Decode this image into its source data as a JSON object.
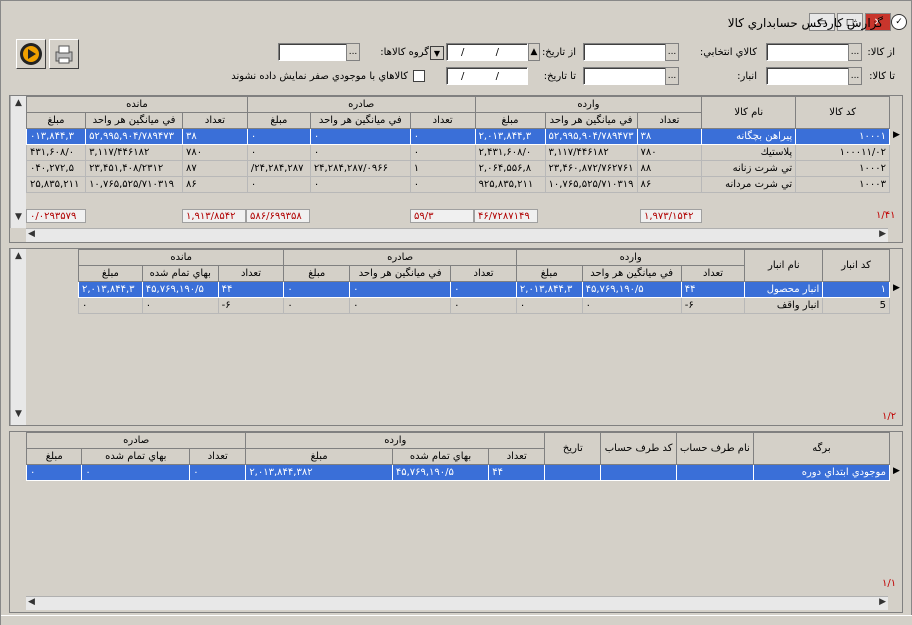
{
  "window": {
    "title": "گزارش كاردكس حسابداري كالا"
  },
  "filters": {
    "from_item_label": "از كالا:",
    "to_item_label": "تا كالا:",
    "selected_items_label": "كالاي انتخابي:",
    "warehouse_label": "انبار:",
    "from_date_label": "از تاريخ:",
    "to_date_label": "تا تاريخ:",
    "item_group_label": "گروه كالاها:",
    "date_placeholder": "/ /",
    "zero_stock_label": "كالاهاي با موجودي صفر نمايش داده نشوند",
    "dots": "..."
  },
  "grid1": {
    "group_headers": {
      "in": "وارده",
      "out": "صادره",
      "rem": "مانده"
    },
    "col_code": "كد كالا",
    "col_name": "نام كالا",
    "col_qty": "تعداد",
    "col_avg": "في ميانگين هر واحد",
    "col_amount": "مبلغ",
    "rows": [
      {
        "code": "۱۰۰۰۱",
        "name": "پيراهن بچگانه",
        "in_qty": "۳۸",
        "in_avg": "۵۲,۹۹۵,۹۰۴/۷۸۹۴۷۳",
        "in_amt": "۲,۰۱۳,۸۴۴,۳",
        "out_qty": "۰",
        "out_avg": "۰",
        "out_amt": "۰",
        "rem_qty": "۳۸",
        "rem_avg": "۵۲,۹۹۵,۹۰۴/۷۸۹۴۷۳",
        "rem_amt": "۰۱۳,۸۴۴,۳"
      },
      {
        "code": "۱۰۰۰۱۱/۰۲",
        "name": "پلاستيك",
        "in_qty": "۷۸۰",
        "in_avg": "۳,۱۱۷/۴۴۶۱۸۲",
        "in_amt": "۲,۴۳۱,۶۰۸/۰",
        "out_qty": "۰",
        "out_avg": "۰",
        "out_amt": "۰",
        "rem_qty": "۷۸۰",
        "rem_avg": "۳,۱۱۷/۴۴۶۱۸۲",
        "rem_amt": "۴۳۱,۶۰۸/۰"
      },
      {
        "code": "۱۰۰۰۲",
        "name": "تي شرت زنانه",
        "in_qty": "۸۸",
        "in_avg": "۲۳,۴۶۰,۸۷۲/۷۶۲۷۶۱",
        "in_amt": "۲,۰۶۴,۵۵۶,۸",
        "out_qty": "۱",
        "out_avg": "۲۴,۲۸۴,۲۸۷/۰۹۶۶",
        "out_amt": "۲۴,۲۸۴,۲۸۷/",
        "rem_qty": "۸۷",
        "rem_avg": "۲۳,۴۵۱,۴۰۸/۲۳۱۲",
        "rem_amt": "۰۴۰,۲۷۲,۵"
      },
      {
        "code": "۱۰۰۰۳",
        "name": "تي شرت مردانه",
        "in_qty": "۸۶",
        "in_avg": "۱۰,۷۶۵,۵۲۵/۷۱۰۳۱۹",
        "in_amt": "۹۲۵,۸۳۵,۲۱۱",
        "out_qty": "۰",
        "out_avg": "۰",
        "out_amt": "۰",
        "rem_qty": "۸۶",
        "rem_avg": "۱۰,۷۶۵,۵۲۵/۷۱۰۳۱۹",
        "rem_amt": "۲۵,۸۳۵,۲۱۱"
      }
    ],
    "footer": {
      "count": "۱/۴۱",
      "f1": "۱,۹۷۳/۱۵۴۲",
      "f2": "۴۶/۷۲۸۷۱۴۹",
      "f3": "۵۹/۳",
      "f4": "۵۸۶/۶۹۹۳۵۸",
      "f5": "۱,۹۱۳/۸۵۴۲",
      "f6": "۰/۰۲۹۳۵۷۹"
    }
  },
  "grid2": {
    "group_headers": {
      "in": "وارده",
      "out": "صادره",
      "rem": "مانده"
    },
    "col_code": "كد انبار",
    "col_name": "نام انبار",
    "col_qty": "تعداد",
    "col_avg": "في ميانگين هر واحد",
    "col_amount": "مبلغ",
    "col_cost": "بهاي تمام شده",
    "rows": [
      {
        "code": "۱",
        "name": "انبار محصول",
        "in_qty": "۴۴",
        "in_avg": "۴۵,۷۶۹,۱۹۰/۵",
        "in_amt": "۲,۰۱۳,۸۴۴,۳",
        "out_qty": "۰",
        "out_avg": "۰",
        "out_amt": "۰",
        "rem_qty": "۴۴",
        "rem_cost": "۴۵,۷۶۹,۱۹۰/۵",
        "rem_amt": "۲,۰۱۳,۸۴۴,۳"
      },
      {
        "code": "5",
        "name": "انبار واقف",
        "in_qty": "۶-",
        "in_avg": "۰",
        "in_amt": "۰",
        "out_qty": "۰",
        "out_avg": "۰",
        "out_amt": "۰",
        "rem_qty": "۶-",
        "rem_cost": "۰",
        "rem_amt": "۰"
      }
    ],
    "count": "۱/۲"
  },
  "grid3": {
    "group_headers": {
      "in": "وارده",
      "out": "صادره"
    },
    "col_sheet": "برگه",
    "col_party_name": "نام طرف حساب",
    "col_party_code": "كد طرف حساب",
    "col_date": "تاريخ",
    "col_qty": "تعداد",
    "col_cost": "بهاي تمام شده",
    "col_amount": "مبلغ",
    "rows": [
      {
        "sheet": "موجودي ابتداي دوره",
        "party_name": "",
        "party_code": "",
        "date": "",
        "in_qty": "۴۴",
        "in_cost": "۴۵,۷۶۹,۱۹۰/۵",
        "in_amt": "۲,۰۱۳,۸۴۴,۳۸۲",
        "out_qty": "۰",
        "out_cost": "۰",
        "out_amt": "۰"
      }
    ],
    "count": "۱/۱"
  }
}
